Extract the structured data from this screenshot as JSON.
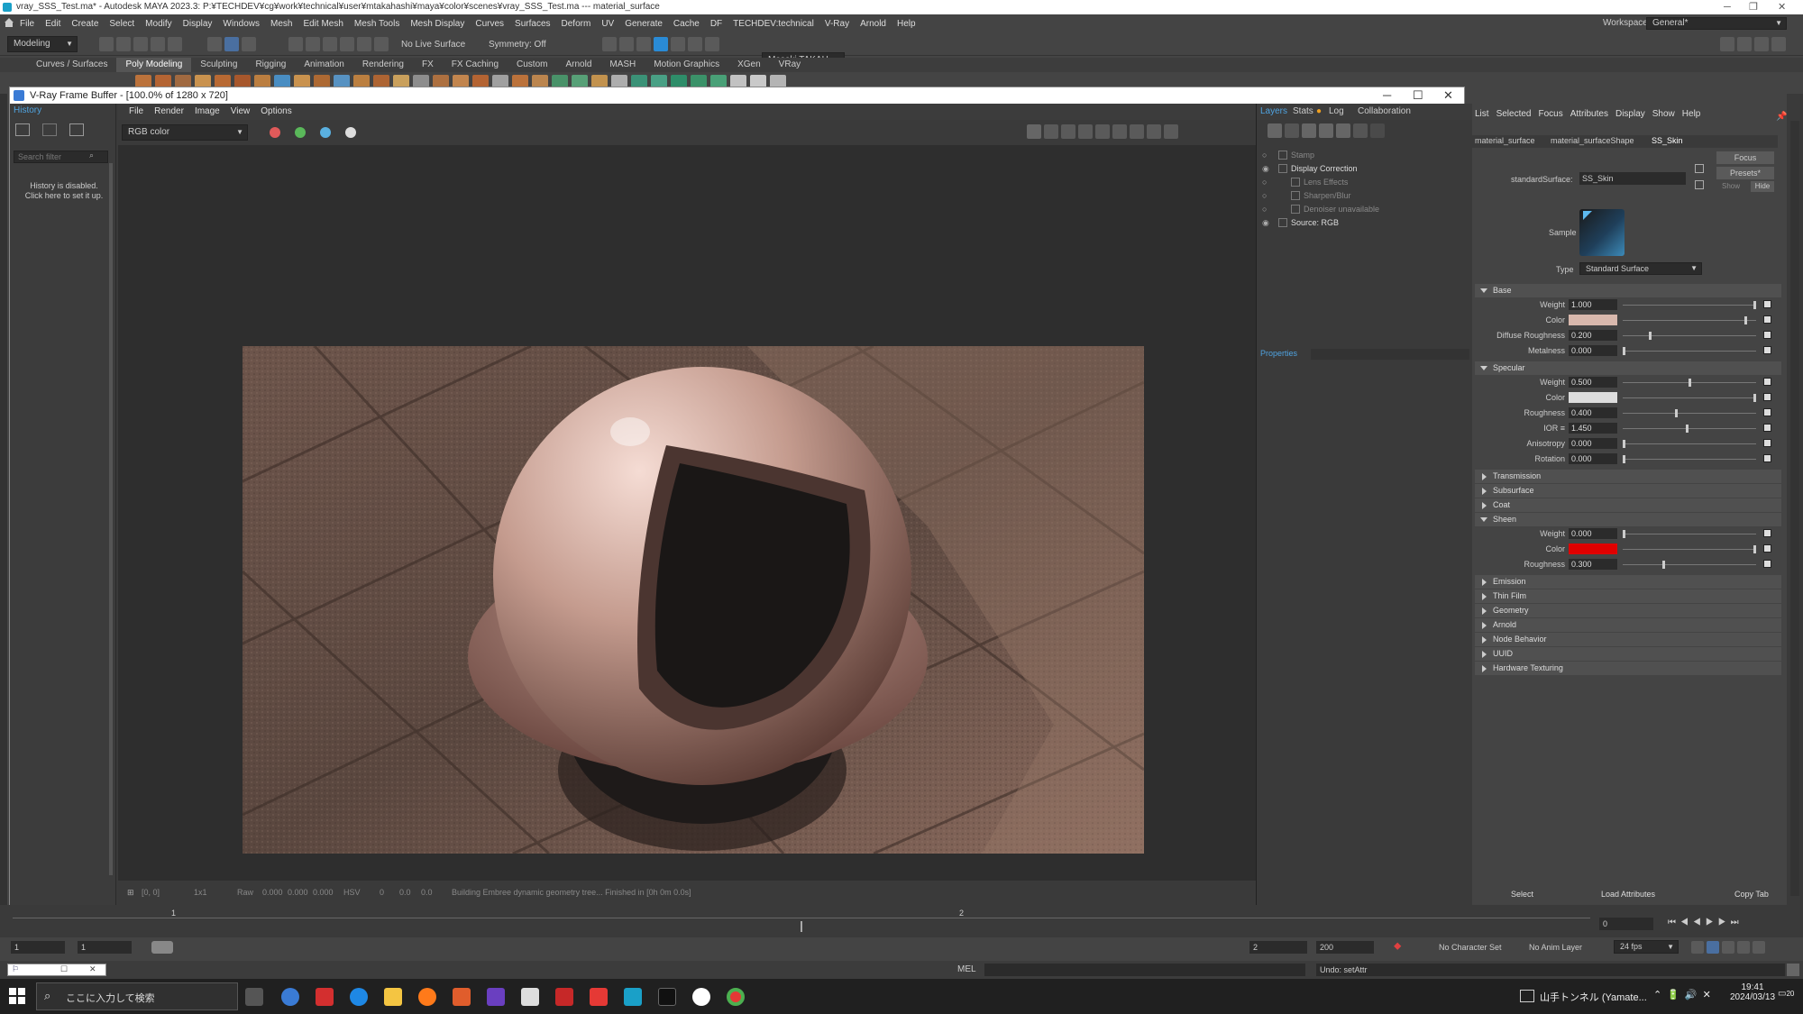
{
  "window": {
    "title": "vray_SSS_Test.ma* - Autodesk MAYA 2023.3: P:¥TECHDEV¥cg¥work¥technical¥user¥mtakahashi¥maya¥color¥scenes¥vray_SSS_Test.ma  ---  material_surface"
  },
  "menu": [
    "File",
    "Edit",
    "Create",
    "Select",
    "Modify",
    "Display",
    "Windows",
    "Mesh",
    "Edit Mesh",
    "Mesh Tools",
    "Mesh Display",
    "Curves",
    "Surfaces",
    "Deform",
    "UV",
    "Generate",
    "Cache",
    "DF",
    "TECHDEV:technical",
    "V-Ray",
    "Arnold",
    "Help"
  ],
  "workspace": {
    "label": "Workspace:",
    "value": "General*"
  },
  "statusline": {
    "mode": "Modeling",
    "live_surface": "No Live Surface",
    "symmetry": "Symmetry: Off",
    "user": "Masaki TAKAH..."
  },
  "shelf_tabs": [
    "Curves / Surfaces",
    "Poly Modeling",
    "Sculpting",
    "Rigging",
    "Animation",
    "Rendering",
    "FX",
    "FX Caching",
    "Custom",
    "Arnold",
    "MASH",
    "Motion Graphics",
    "XGen",
    "VRay"
  ],
  "shelf_active": "Poly Modeling",
  "vfb": {
    "title": "V-Ray Frame Buffer - [100.0% of 1280 x 720]",
    "menu": [
      "File",
      "Render",
      "Image",
      "View",
      "Options"
    ],
    "channel": "RGB color",
    "history_tab": "History",
    "history_search": "Search filter",
    "history_msg": "History is disabled. Click here to set it up.",
    "status": {
      "coords": "[0, 0]",
      "zoom": "1x1",
      "raw": "Raw",
      "r": "0.000",
      "g": "0.000",
      "b": "0.000",
      "colorspace": "HSV",
      "h": "0",
      "s": "0.0",
      "v": "0.0",
      "message": "Building Embree dynamic geometry tree... Finished in [0h 0m 0.0s]"
    }
  },
  "layers_panel": {
    "tabs": [
      "Layers",
      "Stats",
      "Log",
      "Collaboration"
    ],
    "items": [
      "Stamp",
      "Display Correction",
      "Lens Effects",
      "Sharpen/Blur",
      "Denoiser unavailable",
      "Source: RGB"
    ],
    "properties": "Properties"
  },
  "attribute_editor": {
    "menu": [
      "List",
      "Selected",
      "Focus",
      "Attributes",
      "Display",
      "Show",
      "Help"
    ],
    "tabs": [
      "material_surface",
      "material_surfaceShape",
      "SS_Skin"
    ],
    "node_label": "standardSurface:",
    "node_name": "SS_Skin",
    "focus_btn": "Focus",
    "presets_btn": "Presets*",
    "show": "Show",
    "hide": "Hide",
    "sample_label": "Sample",
    "type_label": "Type",
    "type_value": "Standard Surface",
    "base": {
      "title": "Base",
      "weight": "1.000",
      "color": "#d8b8ad",
      "diffuse_roughness": "0.200",
      "metalness": "0.000",
      "labels": {
        "weight": "Weight",
        "color": "Color",
        "diffuse_roughness": "Diffuse Roughness",
        "metalness": "Metalness"
      },
      "sliders": {
        "weight": 1.0,
        "color": 0.93,
        "diffuse_roughness": 0.2,
        "metalness": 0.0
      }
    },
    "specular": {
      "title": "Specular",
      "weight": "0.500",
      "color": "#dddddd",
      "roughness": "0.400",
      "ior": "1.450",
      "anisotropy": "0.000",
      "rotation": "0.000",
      "labels": {
        "weight": "Weight",
        "color": "Color",
        "roughness": "Roughness",
        "ior": "IOR ≡",
        "anisotropy": "Anisotropy",
        "rotation": "Rotation"
      },
      "sliders": {
        "weight": 0.5,
        "color": 1.0,
        "roughness": 0.4,
        "ior": 0.48,
        "anisotropy": 0.0,
        "rotation": 0.0
      }
    },
    "collapsed_1": [
      "Transmission",
      "Subsurface",
      "Coat"
    ],
    "sheen": {
      "title": "Sheen",
      "weight": "0.000",
      "color": "#e00000",
      "roughness": "0.300",
      "labels": {
        "weight": "Weight",
        "color": "Color",
        "roughness": "Roughness"
      },
      "sliders": {
        "weight": 0.0,
        "color": 1.0,
        "roughness": 0.3
      }
    },
    "collapsed_2": [
      "Emission",
      "Thin Film",
      "Geometry",
      "Arnold",
      "Node Behavior",
      "UUID",
      "Hardware Texturing"
    ],
    "buttons": [
      "Select",
      "Load Attributes",
      "Copy Tab"
    ]
  },
  "timeline": {
    "ticks": [
      "1",
      "2"
    ],
    "current": "0"
  },
  "range": {
    "start": "1",
    "start2": "1",
    "end": "2",
    "end2": "200",
    "char_set": "No Character Set",
    "anim_layer": "No Anim Layer",
    "fps": "24 fps"
  },
  "cmd": {
    "lang": "MEL",
    "result": "Undo: setAttr"
  },
  "taskbar": {
    "search": "ここに入力して検索",
    "tray_text": "山手トンネル (Yamate...",
    "time": "19:41",
    "date": "2024/03/13",
    "notif": "20"
  }
}
